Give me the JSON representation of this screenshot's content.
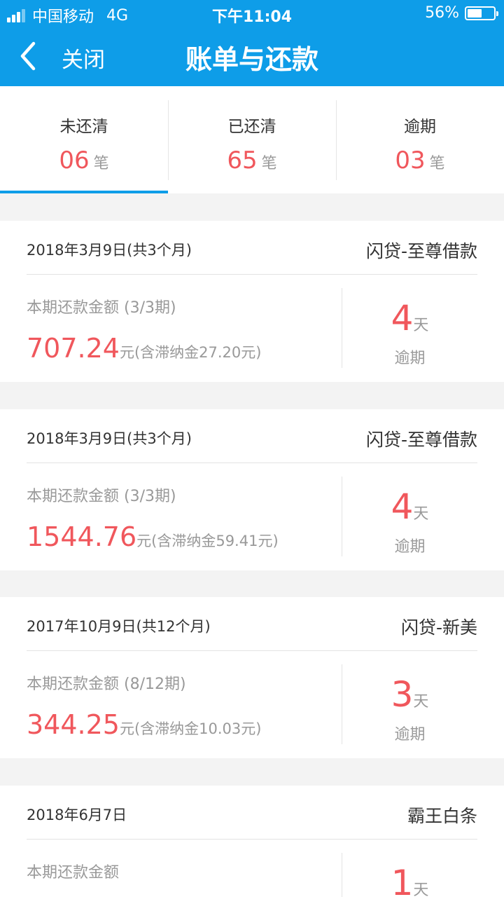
{
  "status_bar": {
    "carrier": "中国移动",
    "network": "4G",
    "time": "下午11:04",
    "battery": "56%",
    "battery_level": 0.56
  },
  "nav": {
    "back_icon": "chevron-left-icon",
    "close_label": "关闭",
    "title": "账单与还款"
  },
  "tabs": [
    {
      "label": "未还清",
      "count": "06",
      "unit": "笔",
      "active": true
    },
    {
      "label": "已还清",
      "count": "65",
      "unit": "笔",
      "active": false
    },
    {
      "label": "逾期",
      "count": "03",
      "unit": "笔",
      "active": false
    }
  ],
  "bills": [
    {
      "date": "2018年3月9日(共3个月)",
      "product": "闪贷-至尊借款",
      "amount_label": "本期还款金额 (3/3期)",
      "amount": "707.24",
      "amount_suffix": "元(含滞纳金27.20元)",
      "days": "4",
      "days_unit": "天",
      "status": "逾期"
    },
    {
      "date": "2018年3月9日(共3个月)",
      "product": "闪贷-至尊借款",
      "amount_label": "本期还款金额 (3/3期)",
      "amount": "1544.76",
      "amount_suffix": "元(含滞纳金59.41元)",
      "days": "4",
      "days_unit": "天",
      "status": "逾期"
    },
    {
      "date": "2017年10月9日(共12个月)",
      "product": "闪贷-新美",
      "amount_label": "本期还款金额 (8/12期)",
      "amount": "344.25",
      "amount_suffix": "元(含滞纳金10.03元)",
      "days": "3",
      "days_unit": "天",
      "status": "逾期"
    },
    {
      "date": "2018年6月7日",
      "product": "霸王白条",
      "amount_label": "本期还款金额",
      "amount": "",
      "amount_suffix": "",
      "days": "1",
      "days_unit": "天",
      "status": ""
    }
  ],
  "colors": {
    "brand_blue": "#0e9de8",
    "accent_red": "#f0575c",
    "muted_text": "#999999"
  }
}
